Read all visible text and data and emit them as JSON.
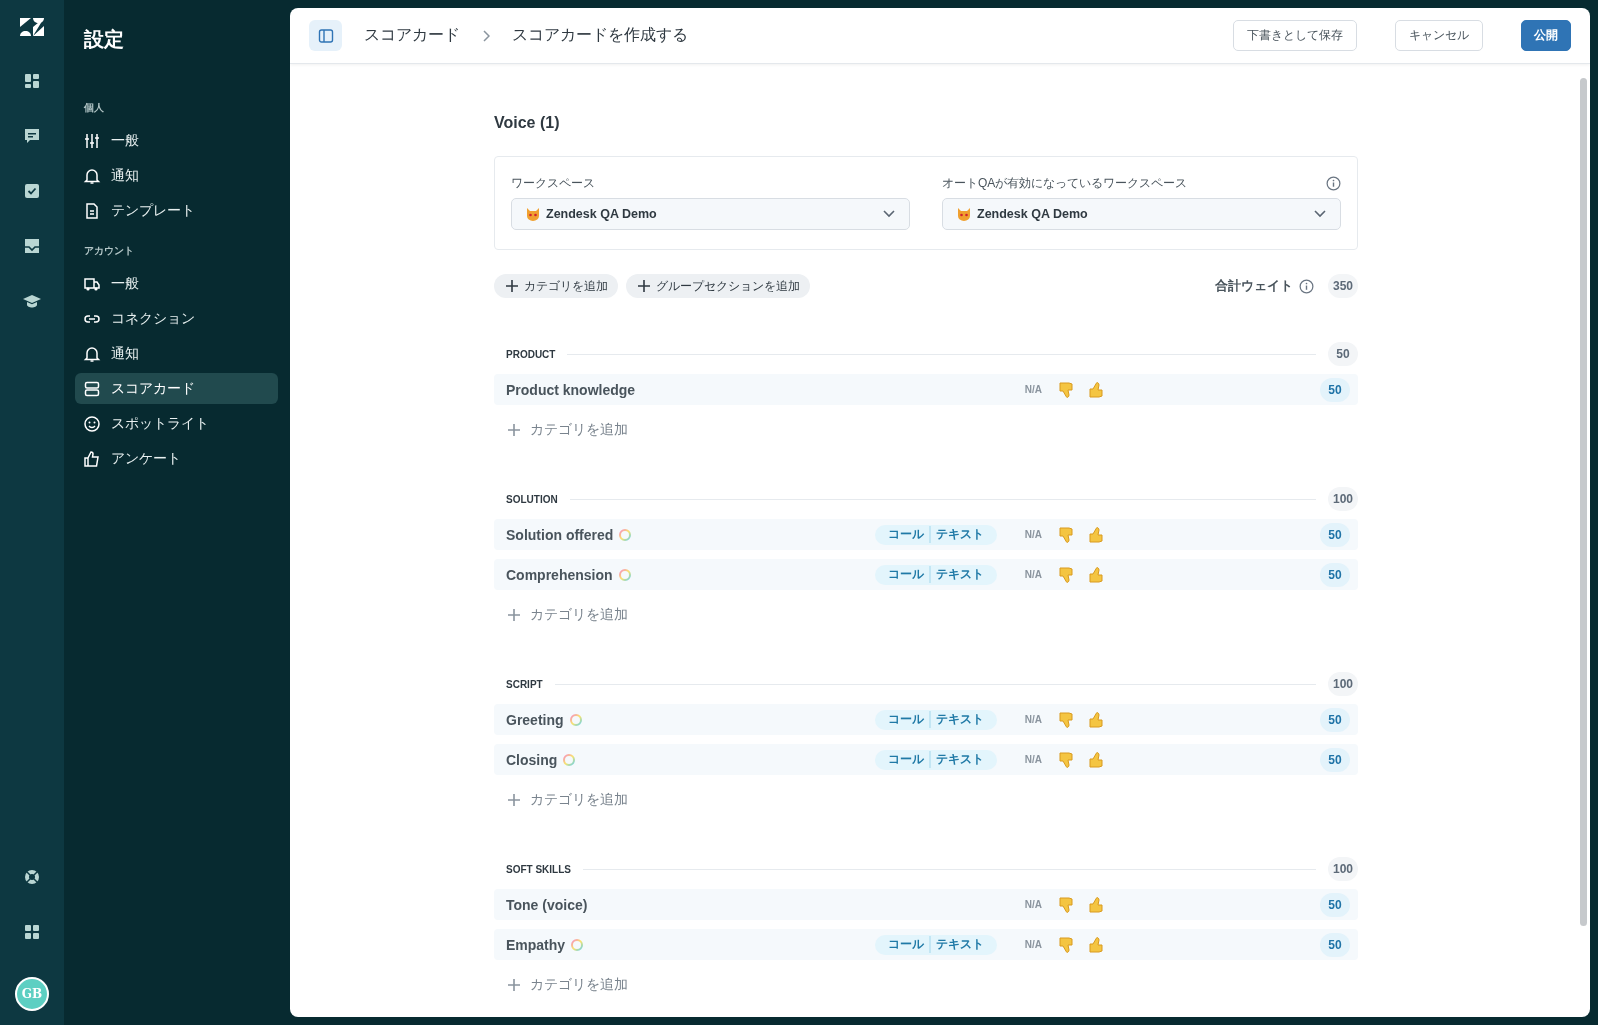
{
  "rail": {
    "avatar": "GB"
  },
  "sidebar": {
    "title": "設定",
    "groups": [
      {
        "heading": "個人",
        "items": [
          {
            "label": "一般",
            "selected": false
          },
          {
            "label": "通知",
            "selected": false
          },
          {
            "label": "テンプレート",
            "selected": false
          }
        ]
      },
      {
        "heading": "アカウント",
        "items": [
          {
            "label": "一般",
            "selected": false
          },
          {
            "label": "コネクション",
            "selected": false
          },
          {
            "label": "通知",
            "selected": false
          },
          {
            "label": "スコアカード",
            "selected": true
          },
          {
            "label": "スポットライト",
            "selected": false
          },
          {
            "label": "アンケート",
            "selected": false
          }
        ]
      }
    ]
  },
  "header": {
    "breadcrumb": [
      "スコアカード",
      "スコアカードを作成する"
    ],
    "buttons": [
      {
        "label": "下書きとして保存",
        "kind": "secondary"
      },
      {
        "label": "キャンセル",
        "kind": "secondary"
      },
      {
        "label": "公開",
        "kind": "primary"
      }
    ]
  },
  "title": "Voice (1)",
  "workspaces": [
    {
      "label": "ワークスペース",
      "value": "Zendesk QA Demo",
      "info": false
    },
    {
      "label": "オートQAが有効になっているワークスペース",
      "value": "Zendesk QA Demo",
      "info": true
    }
  ],
  "actions": [
    "カテゴリを追加",
    "グループセクションを追加"
  ],
  "total_weight": {
    "label": "合計ウェイト",
    "value": "350"
  },
  "sections": [
    {
      "title": "PRODUCT",
      "weight": "50",
      "add_label": "カテゴリを追加",
      "categories": [
        {
          "name": "Product knowledge",
          "auto_qa": false,
          "na": "N/A",
          "weight": "50"
        }
      ]
    },
    {
      "title": "SOLUTION",
      "weight": "100",
      "add_label": "カテゴリを追加",
      "categories": [
        {
          "name": "Solution offered",
          "auto_qa": true,
          "channels": [
            "コール",
            "テキスト"
          ],
          "na": "N/A",
          "weight": "50"
        },
        {
          "name": "Comprehension",
          "auto_qa": true,
          "channels": [
            "コール",
            "テキスト"
          ],
          "na": "N/A",
          "weight": "50"
        }
      ]
    },
    {
      "title": "SCRIPT",
      "weight": "100",
      "add_label": "カテゴリを追加",
      "categories": [
        {
          "name": "Greeting",
          "auto_qa": true,
          "channels": [
            "コール",
            "テキスト"
          ],
          "na": "N/A",
          "weight": "50"
        },
        {
          "name": "Closing",
          "auto_qa": true,
          "channels": [
            "コール",
            "テキスト"
          ],
          "na": "N/A",
          "weight": "50"
        }
      ]
    },
    {
      "title": "SOFT SKILLS",
      "weight": "100",
      "add_label": "カテゴリを追加",
      "categories": [
        {
          "name": "Tone (voice)",
          "auto_qa": false,
          "na": "N/A",
          "weight": "50"
        },
        {
          "name": "Empathy",
          "auto_qa": true,
          "channels": [
            "コール",
            "テキスト"
          ],
          "na": "N/A",
          "weight": "50"
        }
      ]
    }
  ]
}
